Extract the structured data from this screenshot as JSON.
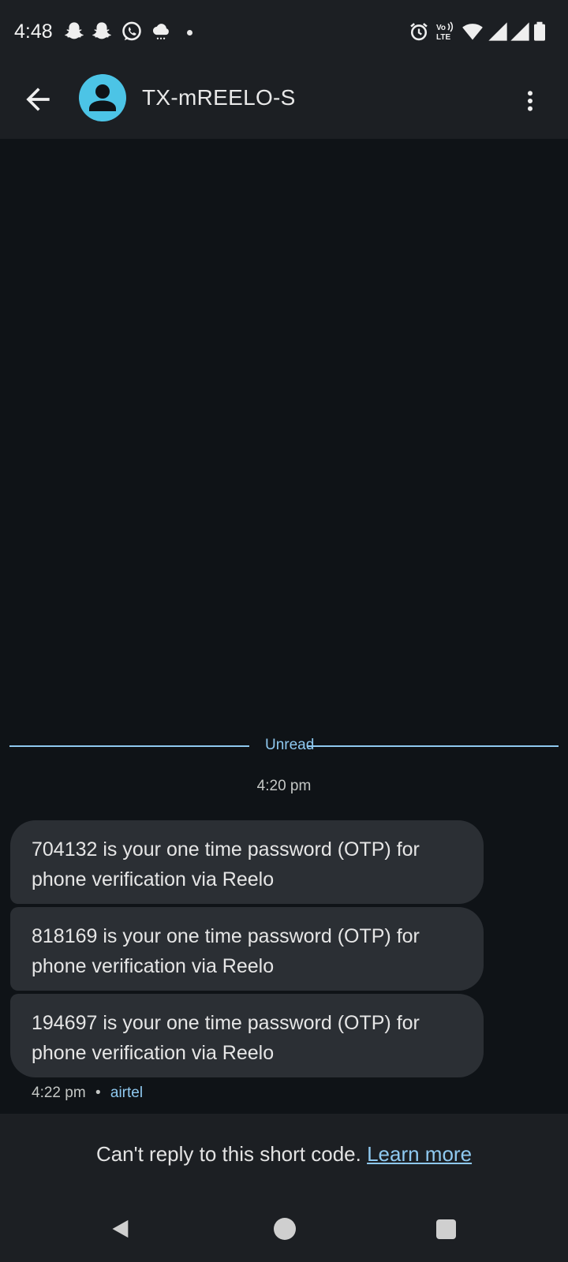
{
  "status_bar": {
    "time": "4:48",
    "left_icons": [
      "snapchat-icon",
      "snapchat-icon",
      "whatsapp-icon",
      "weather-icon",
      "notification-dot"
    ],
    "right_icons": [
      "alarm-icon",
      "volte-icon",
      "wifi-icon",
      "signal-icon",
      "signal-icon",
      "battery-icon"
    ],
    "volte_label": "Vo LTE"
  },
  "app_bar": {
    "back_icon": "arrow-back-icon",
    "avatar_icon": "person-icon",
    "avatar_color": "#4cc4e6",
    "title": "TX-mREELO-S",
    "menu_icon": "more-vert-icon"
  },
  "conversation": {
    "unread_label": "Unread",
    "timestamp": "4:20 pm",
    "messages": [
      {
        "text": "704132 is your one time password (OTP) for phone verification via Reelo"
      },
      {
        "text": "818169 is your one time password (OTP) for phone verification via Reelo"
      },
      {
        "text": "194697 is your one time password (OTP) for phone verification via Reelo"
      }
    ],
    "meta_time": "4:22 pm",
    "meta_separator": "•",
    "meta_carrier": "airtel"
  },
  "footer": {
    "text": "Can't reply to this short code.",
    "link": "Learn more"
  },
  "nav_bar": {
    "icons": [
      "nav-back-icon",
      "nav-home-icon",
      "nav-recents-icon"
    ]
  },
  "colors": {
    "background": "#0f1317",
    "surface": "#1c1f23",
    "bubble": "#2b2f34",
    "accent": "#8fc9f0"
  }
}
